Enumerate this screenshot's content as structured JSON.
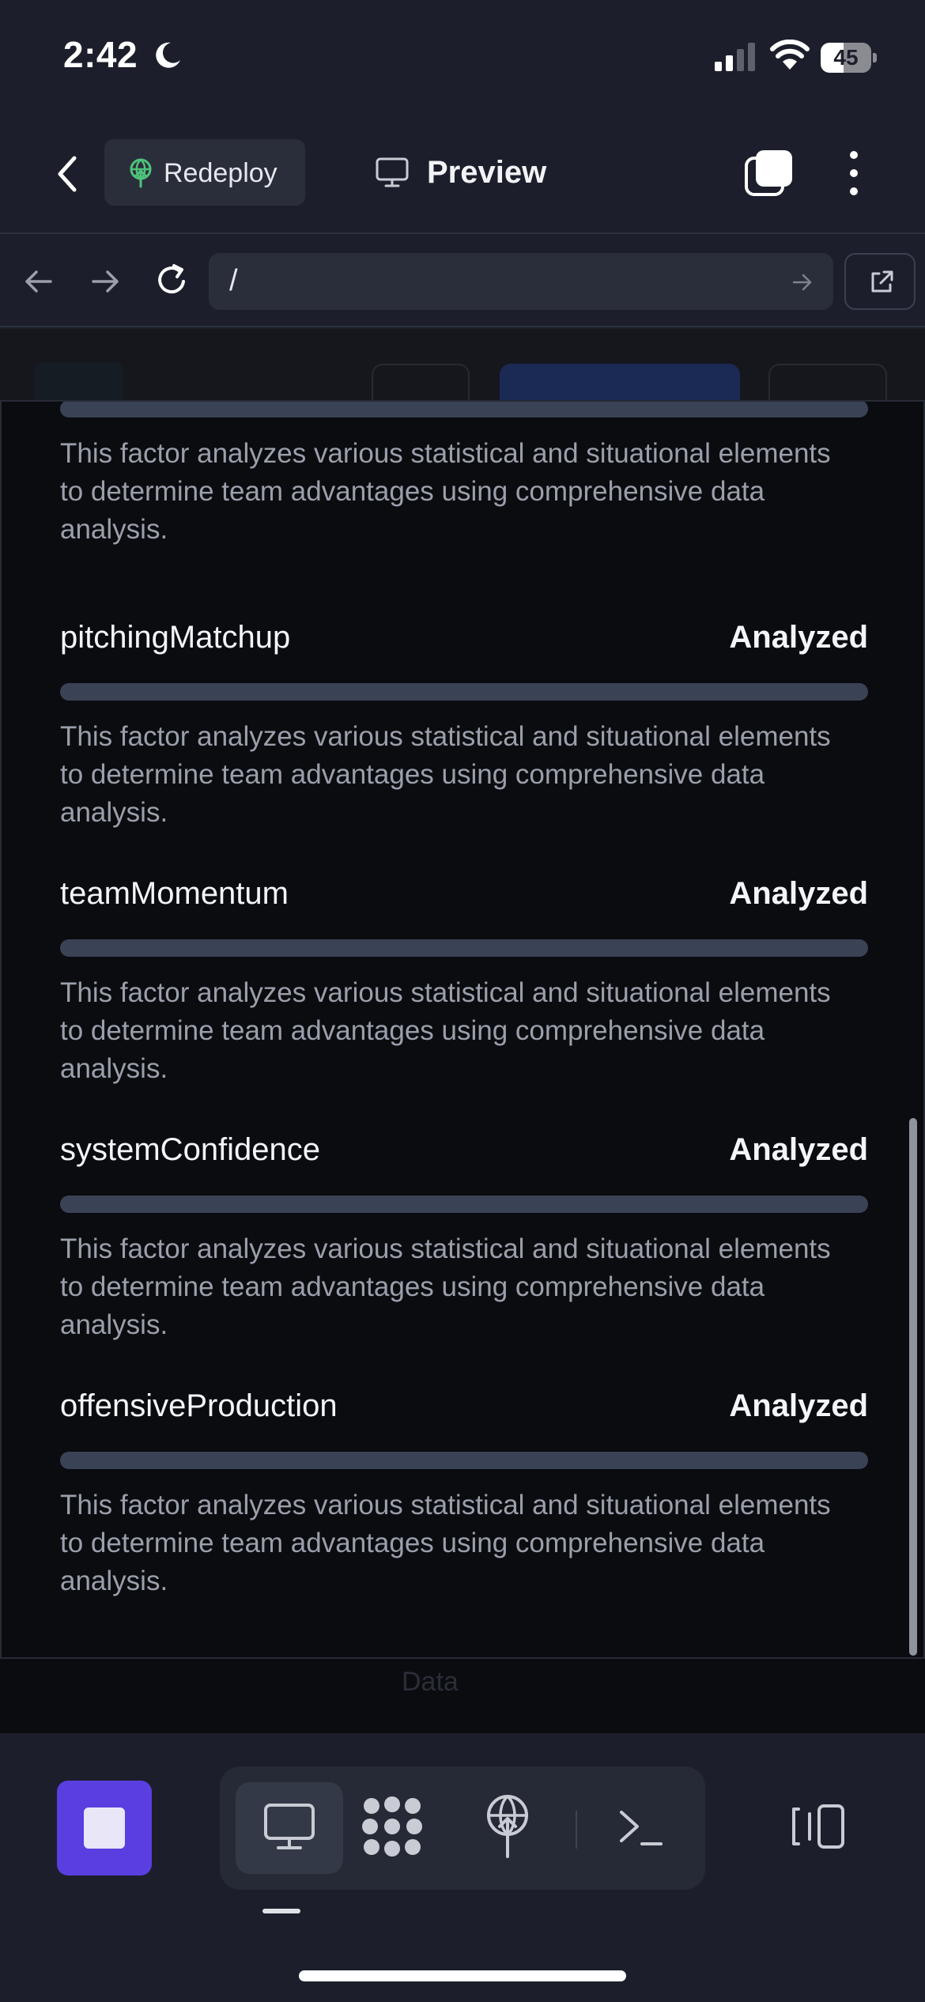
{
  "status_bar": {
    "time": "2:42",
    "battery_level": "45"
  },
  "header": {
    "redeploy_label": "Redeploy",
    "preview_label": "Preview"
  },
  "url_bar": {
    "url": "/"
  },
  "factors": [
    {
      "name": "",
      "status": "",
      "description": "This factor analyzes various statistical and situational elements to determine team advantages using comprehensive data analysis."
    },
    {
      "name": "pitchingMatchup",
      "status": "Analyzed",
      "description": "This factor analyzes various statistical and situational elements to determine team advantages using comprehensive data analysis."
    },
    {
      "name": "teamMomentum",
      "status": "Analyzed",
      "description": "This factor analyzes various statistical and situational elements to determine team advantages using comprehensive data analysis."
    },
    {
      "name": "systemConfidence",
      "status": "Analyzed",
      "description": "This factor analyzes various statistical and situational elements to determine team advantages using comprehensive data analysis."
    },
    {
      "name": "offensiveProduction",
      "status": "Analyzed",
      "description": "This factor analyzes various statistical and situational elements to determine team advantages using comprehensive data analysis."
    }
  ],
  "below_panel": {
    "ghost_label": "Data"
  },
  "toolbar": {
    "icons": [
      "stop-icon",
      "monitor-icon",
      "grid-icon",
      "deploy-icon",
      "terminal-icon",
      "panels-icon"
    ]
  },
  "colors": {
    "accent": "#5b3ee0",
    "background": "#1c1f2b",
    "page_background": "#0b0c10",
    "bar": "#3a4255",
    "muted_text": "#9a9fab"
  }
}
